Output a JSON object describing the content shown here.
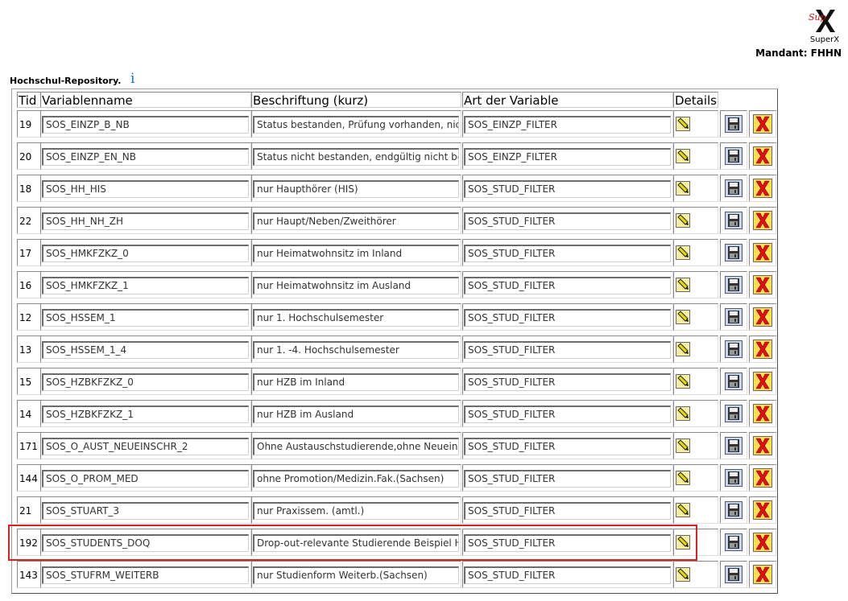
{
  "header": {
    "logo_text": "SuperX",
    "mandant": "Mandant: FHHN"
  },
  "repository": {
    "title": "Hochschul-Repository.",
    "info_icon": "i"
  },
  "table": {
    "columns": [
      "Tid",
      "Variablenname",
      "Beschriftung (kurz)",
      "Art der Variable",
      "Details"
    ],
    "rows": [
      {
        "tid": "19",
        "name": "SOS_EINZP_B_NB",
        "label": "Status bestanden, Prüfung vorhanden, nicht",
        "art": "SOS_EINZP_FILTER"
      },
      {
        "tid": "20",
        "name": "SOS_EINZP_EN_NB",
        "label": "Status nicht bestanden, endgültig nicht bes",
        "art": "SOS_EINZP_FILTER"
      },
      {
        "tid": "18",
        "name": "SOS_HH_HIS",
        "label": "nur Haupthörer (HIS)",
        "art": "SOS_STUD_FILTER"
      },
      {
        "tid": "22",
        "name": "SOS_HH_NH_ZH",
        "label": "nur Haupt/Neben/Zweithörer",
        "art": "SOS_STUD_FILTER"
      },
      {
        "tid": "17",
        "name": "SOS_HMKFZKZ_0",
        "label": "nur Heimatwohnsitz im Inland",
        "art": "SOS_STUD_FILTER"
      },
      {
        "tid": "16",
        "name": "SOS_HMKFZKZ_1",
        "label": "nur Heimatwohnsitz im Ausland",
        "art": "SOS_STUD_FILTER"
      },
      {
        "tid": "12",
        "name": "SOS_HSSEM_1",
        "label": "nur 1. Hochschulsemester",
        "art": "SOS_STUD_FILTER"
      },
      {
        "tid": "13",
        "name": "SOS_HSSEM_1_4",
        "label": "nur 1. -4. Hochschulsemester",
        "art": "SOS_STUD_FILTER"
      },
      {
        "tid": "15",
        "name": "SOS_HZBKFZKZ_0",
        "label": "nur HZB im Inland",
        "art": "SOS_STUD_FILTER"
      },
      {
        "tid": "14",
        "name": "SOS_HZBKFZKZ_1",
        "label": "nur HZB im Ausland",
        "art": "SOS_STUD_FILTER"
      },
      {
        "tid": "171",
        "name": "SOS_O_AUST_NEUEINSCHR_2",
        "label": "Ohne Austauschstudierende,ohne Neueinsc",
        "art": "SOS_STUD_FILTER"
      },
      {
        "tid": "144",
        "name": "SOS_O_PROM_MED",
        "label": "ohne Promotion/Medizin.Fak.(Sachsen)",
        "art": "SOS_STUD_FILTER"
      },
      {
        "tid": "21",
        "name": "SOS_STUART_3",
        "label": "nur Praxissem. (amtl.)",
        "art": "SOS_STUD_FILTER"
      },
      {
        "tid": "192",
        "name": "SOS_STUDENTS_DOQ",
        "label": "Drop-out-relevante Studierende Beispiel Hei",
        "art": "SOS_STUD_FILTER",
        "highlighted": true
      },
      {
        "tid": "143",
        "name": "SOS_STUFRM_WEITERB",
        "label": "nur Studienform Weiterb.(Sachsen)",
        "art": "SOS_STUD_FILTER"
      }
    ]
  },
  "icons": {
    "details": "pencil-icon",
    "save": "floppy-disk-icon",
    "delete": "red-x-delete-icon"
  },
  "colors": {
    "highlight": "#e02020",
    "info": "#1a6fd6",
    "delete": "#e01010",
    "pencil": "#e8d800"
  }
}
